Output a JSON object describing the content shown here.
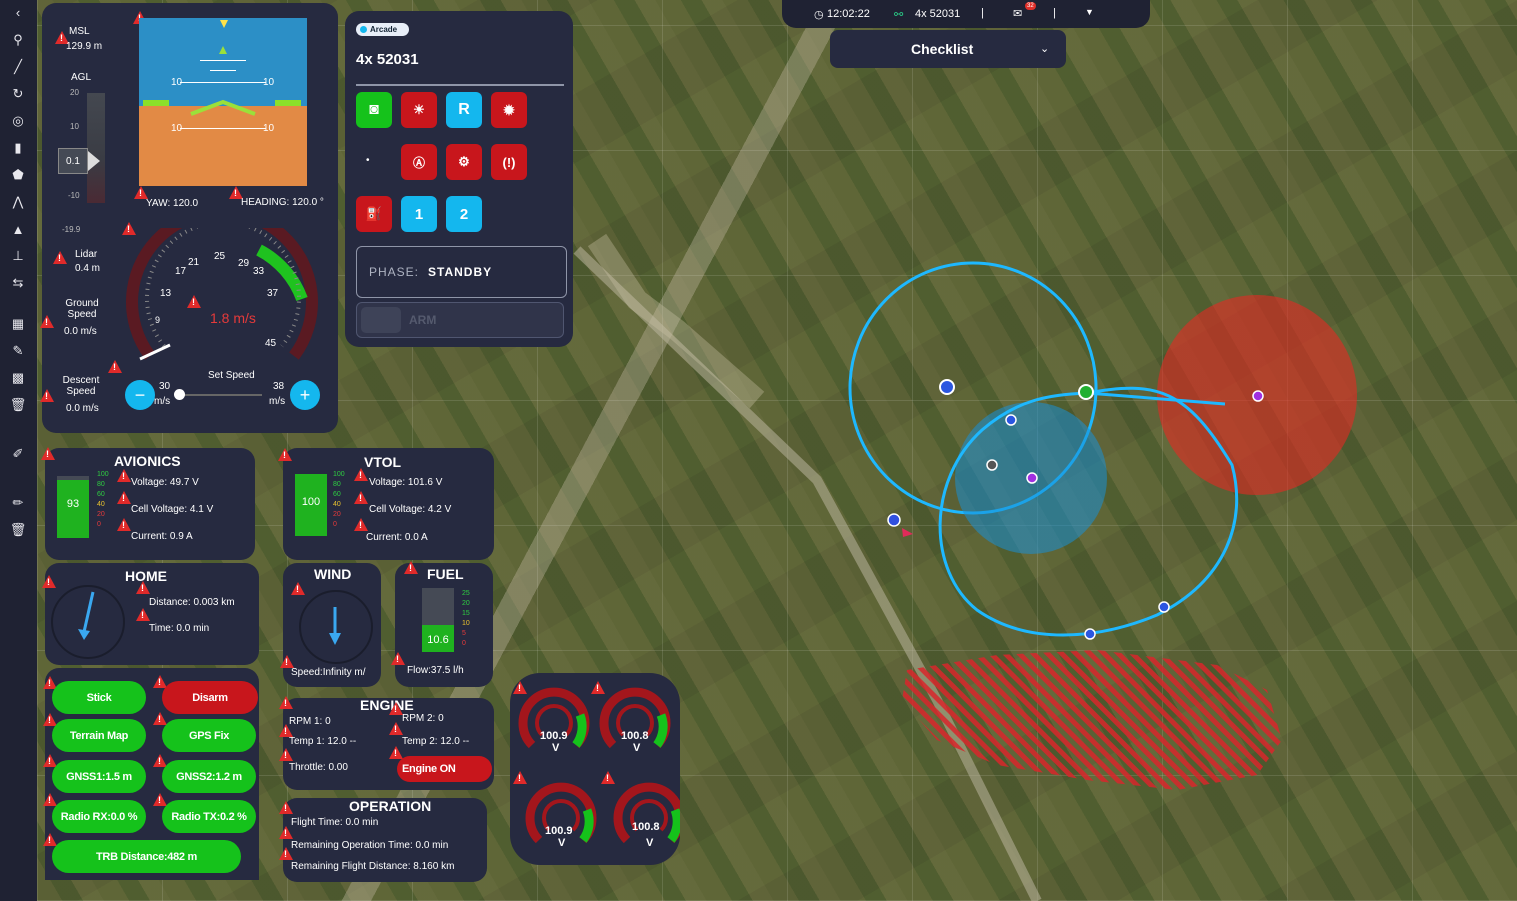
{
  "status_bar": {
    "time": "12:02:22",
    "vehicle": "4x 52031",
    "msg_count": "32"
  },
  "checklist": {
    "label": "Checklist"
  },
  "attitude": {
    "msl_label": "MSL",
    "msl_value": "129.9 m",
    "agl_label": "AGL",
    "agl_ticks": [
      "20",
      "10",
      "-10",
      "-19.9"
    ],
    "agl_value": "0.1",
    "pitch_labels": [
      "10",
      "10",
      "10",
      "10"
    ],
    "yaw": "YAW: 120.0",
    "heading": "HEADING: 120.0 °",
    "lidar_label": "Lidar",
    "lidar_value": "0.4 m",
    "ground_speed_label": "Ground Speed",
    "ground_speed_value": "0.0 m/s",
    "descent_speed_label": "Descent Speed",
    "descent_speed_value": "0.0 m/s",
    "speed_ticks": [
      "9",
      "13",
      "17",
      "21",
      "25",
      "29",
      "33",
      "37",
      "45"
    ],
    "speed_value": "1.8 m/s",
    "set_speed_label": "Set Speed",
    "set_speed_min": "30",
    "set_speed_max": "38",
    "set_speed_unit": "m/s"
  },
  "vehicle_panel": {
    "mode": "Arcade",
    "name": "4x 52031",
    "buttons_row3": [
      "R"
    ],
    "buttons_row5": [
      "1",
      "2"
    ],
    "phase_label": "PHASE:",
    "phase_value": "STANDBY",
    "arm_label": "ARM"
  },
  "avionics": {
    "title": "AVIONICS",
    "level": "93",
    "voltage": "Voltage: 49.7 V",
    "cell": "Cell Voltage: 4.1 V",
    "current": "Current: 0.9 A",
    "scale": [
      "100",
      "80",
      "60",
      "40",
      "20",
      "0"
    ]
  },
  "vtol": {
    "title": "VTOL",
    "level": "100",
    "voltage": "Voltage: 101.6 V",
    "cell": "Cell Voltage: 4.2 V",
    "current": "Current: 0.0 A",
    "scale": [
      "100",
      "80",
      "60",
      "40",
      "20",
      "0"
    ]
  },
  "home": {
    "title": "HOME",
    "distance": "Distance: 0.003 km",
    "time": "Time: 0.0 min"
  },
  "wind": {
    "title": "WIND",
    "speed": "Speed:Infinity m/"
  },
  "fuel": {
    "title": "FUEL",
    "level": "10.6",
    "flow": "Flow:37.5 l/h",
    "scale": [
      "25",
      "20",
      "15",
      "10",
      "5",
      "0"
    ]
  },
  "status_buttons": {
    "stick": "Stick",
    "disarm": "Disarm",
    "terrain": "Terrain Map",
    "gps": "GPS Fix",
    "gnss1": "GNSS1:1.5 m",
    "gnss2": "GNSS2:1.2 m",
    "radio_rx": "Radio RX:0.0 %",
    "radio_tx": "Radio TX:0.2 %",
    "trb": "TRB Distance:482 m"
  },
  "engine": {
    "title": "ENGINE",
    "rpm1": "RPM 1: 0",
    "rpm2": "RPM 2: 0",
    "temp1": "Temp 1: 12.0 --",
    "temp2": "Temp 2: 12.0 --",
    "throttle": "Throttle: 0.00",
    "engine_on": "Engine ON"
  },
  "operation": {
    "title": "OPERATION",
    "flight_time": "Flight Time: 0.0 min",
    "remaining_time": "Remaining Operation Time: 0.0 min",
    "remaining_dist": "Remaining Flight Distance: 8.160 km"
  },
  "voltage_gauges": [
    {
      "value": "100.9",
      "unit": "V"
    },
    {
      "value": "100.8",
      "unit": "V"
    },
    {
      "value": "100.9",
      "unit": "V"
    },
    {
      "value": "100.8",
      "unit": "V"
    }
  ]
}
